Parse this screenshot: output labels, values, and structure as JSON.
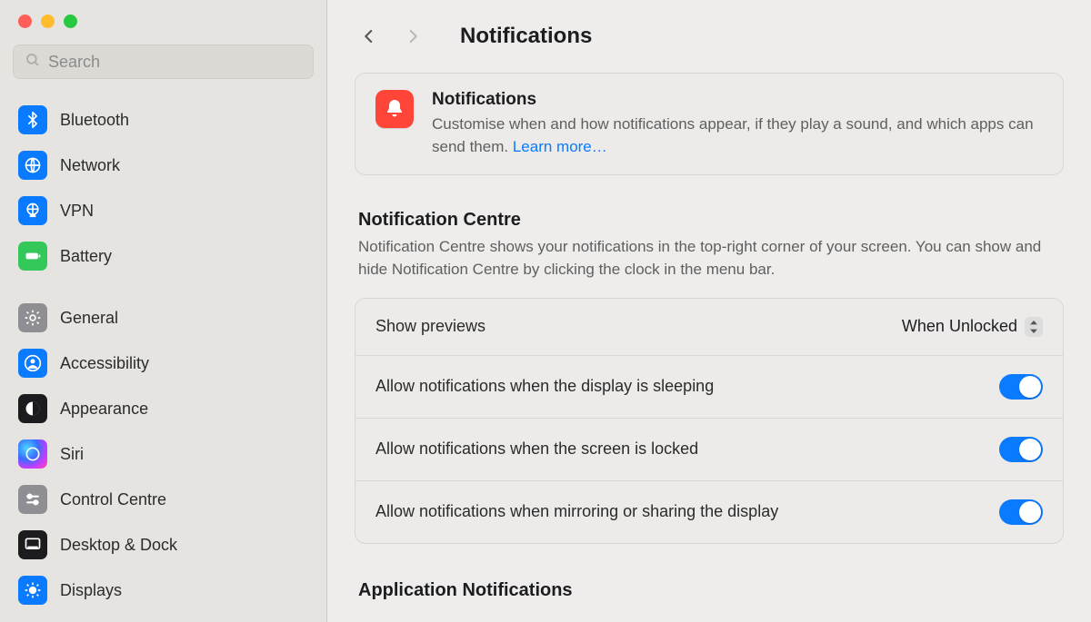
{
  "window": {
    "title": "Notifications"
  },
  "search": {
    "placeholder": "Search",
    "value": ""
  },
  "sidebar": {
    "group1": [
      {
        "id": "bluetooth",
        "label": "Bluetooth",
        "icon": "bluetooth-icon",
        "tint": "ic-blue"
      },
      {
        "id": "network",
        "label": "Network",
        "icon": "globe-icon",
        "tint": "ic-blue"
      },
      {
        "id": "vpn",
        "label": "VPN",
        "icon": "globe-lock-icon",
        "tint": "ic-blue"
      },
      {
        "id": "battery",
        "label": "Battery",
        "icon": "battery-icon",
        "tint": "ic-green"
      }
    ],
    "group2": [
      {
        "id": "general",
        "label": "General",
        "icon": "gear-icon",
        "tint": "ic-gray"
      },
      {
        "id": "accessibility",
        "label": "Accessibility",
        "icon": "person-icon",
        "tint": "ic-blue"
      },
      {
        "id": "appearance",
        "label": "Appearance",
        "icon": "contrast-icon",
        "tint": "ic-black"
      },
      {
        "id": "siri",
        "label": "Siri",
        "icon": "siri-icon",
        "tint": "ic-siri"
      },
      {
        "id": "controlcentre",
        "label": "Control Centre",
        "icon": "switches-icon",
        "tint": "ic-gray"
      },
      {
        "id": "desktopdock",
        "label": "Desktop & Dock",
        "icon": "dock-icon",
        "tint": "ic-black"
      },
      {
        "id": "displays",
        "label": "Displays",
        "icon": "sun-icon",
        "tint": "ic-blue"
      }
    ]
  },
  "intro": {
    "heading": "Notifications",
    "body": "Customise when and how notifications appear, if they play a sound, and which apps can send them. ",
    "link": "Learn more…"
  },
  "notificationCentre": {
    "heading": "Notification Centre",
    "body": "Notification Centre shows your notifications in the top-right corner of your screen. You can show and hide Notification Centre by clicking the clock in the menu bar."
  },
  "settings": {
    "previews_label": "Show previews",
    "previews_value": "When Unlocked",
    "sleep_label": "Allow notifications when the display is sleeping",
    "sleep_on": true,
    "locked_label": "Allow notifications when the screen is locked",
    "locked_on": true,
    "mirror_label": "Allow notifications when mirroring or sharing the display",
    "mirror_on": true
  },
  "appSection": {
    "heading": "Application Notifications"
  }
}
